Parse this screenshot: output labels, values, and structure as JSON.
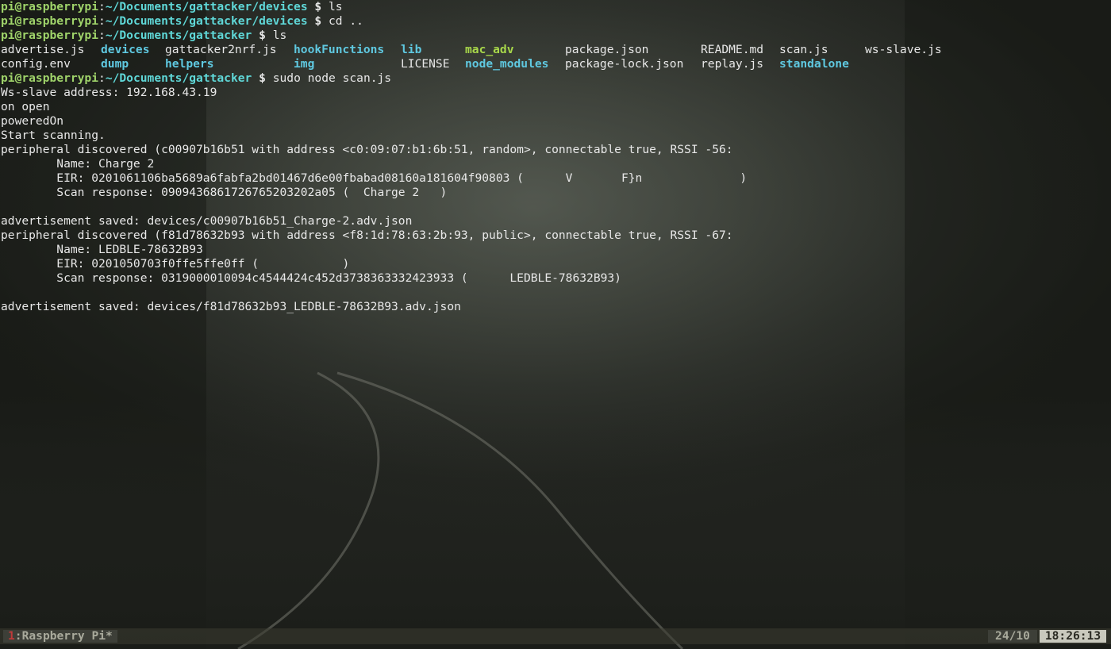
{
  "prompt": {
    "user": "pi@raspberrypi",
    "colon": ":",
    "dollar": "$"
  },
  "lines": [
    {
      "path": "~/Documents/gattacker/devices",
      "cmd": "ls"
    },
    {
      "path": "~/Documents/gattacker/devices",
      "cmd": "cd .."
    },
    {
      "path": "~/Documents/gattacker",
      "cmd": "ls"
    }
  ],
  "ls_row1": [
    {
      "name": "advertise.js",
      "kind": "file"
    },
    {
      "name": "devices",
      "kind": "dir"
    },
    {
      "name": "gattacker2nrf.js",
      "kind": "file"
    },
    {
      "name": "hookFunctions",
      "kind": "dir"
    },
    {
      "name": "lib",
      "kind": "dir"
    },
    {
      "name": "mac_adv",
      "kind": "exec"
    },
    {
      "name": "package.json",
      "kind": "file"
    },
    {
      "name": "README.md",
      "kind": "file"
    },
    {
      "name": "scan.js",
      "kind": "file"
    },
    {
      "name": "ws-slave.js",
      "kind": "file"
    }
  ],
  "ls_row2": [
    {
      "name": "config.env",
      "kind": "file"
    },
    {
      "name": "dump",
      "kind": "dir"
    },
    {
      "name": "helpers",
      "kind": "dir"
    },
    {
      "name": "img",
      "kind": "dir"
    },
    {
      "name": "LICENSE",
      "kind": "file"
    },
    {
      "name": "node_modules",
      "kind": "dir"
    },
    {
      "name": "package-lock.json",
      "kind": "file"
    },
    {
      "name": "replay.js",
      "kind": "file"
    },
    {
      "name": "standalone",
      "kind": "dir"
    }
  ],
  "scan_cmd": {
    "path": "~/Documents/gattacker",
    "cmd": "sudo node scan.js"
  },
  "output": [
    "Ws-slave address: 192.168.43.19",
    "on open",
    "poweredOn",
    "Start scanning.",
    "peripheral discovered (c00907b16b51 with address <c0:09:07:b1:6b:51, random>, connectable true, RSSI -56:",
    "        Name: Charge 2",
    "        EIR: 0201061106ba5689a6fabfa2bd01467d6e00fbabad08160a181604f90803 (      V       F}n              )",
    "        Scan response: 0909436861726765203202a05 (  Charge 2   )",
    "",
    "advertisement saved: devices/c00907b16b51_Charge-2.adv.json",
    "peripheral discovered (f81d78632b93 with address <f8:1d:78:63:2b:93, public>, connectable true, RSSI -67:",
    "        Name: LEDBLE-78632B93",
    "        EIR: 0201050703f0ffe5ffe0ff (            )",
    "        Scan response: 0319000010094c4544424c452d3738363332423933 (      LEDBLE-78632B93)",
    "",
    "advertisement saved: devices/f81d78632b93_LEDBLE-78632B93.adv.json"
  ],
  "statusbar": {
    "window_index": "1",
    "window_sep": ":",
    "window_name": "Raspberry Pi",
    "window_flag": "*",
    "load": "24/10",
    "clock": "18:26:13"
  },
  "colors": {
    "prompt_user": "#9fd36a",
    "prompt_path": "#5fd7d7",
    "directory": "#5fc8e0",
    "executable": "#a8d84a",
    "text": "#e8e8e8",
    "window_index": "#c03a3a"
  }
}
